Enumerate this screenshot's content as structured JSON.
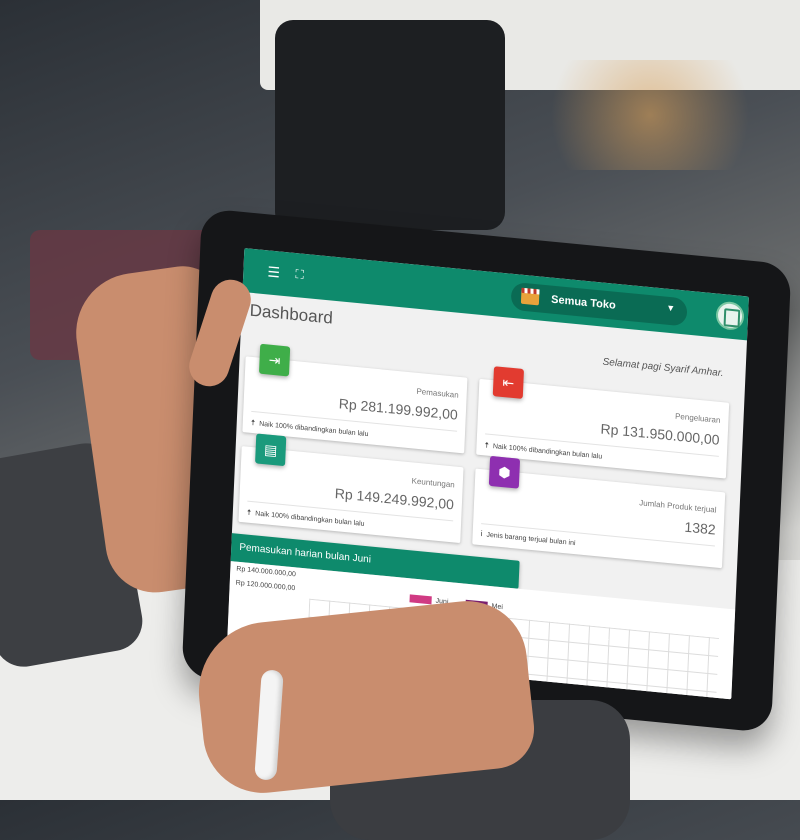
{
  "topbar": {
    "menu_icon": "menu-icon",
    "fullscreen_icon": "fullscreen-icon",
    "store_select": {
      "value": "Semua Toko",
      "icon": "store-icon"
    },
    "avatar_icon": "avatar-icon"
  },
  "dashboard": {
    "title": "Dashboard",
    "greeting": "Selamat pagi Syarif Amhar.",
    "cards": [
      {
        "label": "Pemasukan",
        "value": "Rp 281.199.992,00",
        "footer": "Naik 100% dibandingkan bulan lalu",
        "icon": "bank-in-icon",
        "color": "#3fae49"
      },
      {
        "label": "Pengeluaran",
        "value": "Rp 131.950.000,00",
        "footer": "Naik 100% dibandingkan bulan lalu",
        "icon": "bank-out-icon",
        "color": "#e23b30"
      },
      {
        "label": "Keuntungan",
        "value": "Rp 149.249.992,00",
        "footer": "Naik 100% dibandingkan bulan lalu",
        "icon": "store-front-icon",
        "color": "#1a9a7c"
      },
      {
        "label": "Jumlah Produk terjual",
        "value": "1382",
        "footer": "Jenis barang terjual bulan ini",
        "icon": "box-icon",
        "color": "#8e2fb0"
      }
    ]
  },
  "chart_section": {
    "title": "Pemasukan harian bulan Juni"
  },
  "chart_data": {
    "type": "line",
    "title": "Pemasukan harian bulan Juni",
    "y_ticks": [
      "Rp 140.000.000,00",
      "Rp 120.000.000,00"
    ],
    "series": [
      {
        "name": "Juni",
        "color": "#d03a83"
      },
      {
        "name": "Mei",
        "color": "#7a1f6e"
      }
    ]
  }
}
